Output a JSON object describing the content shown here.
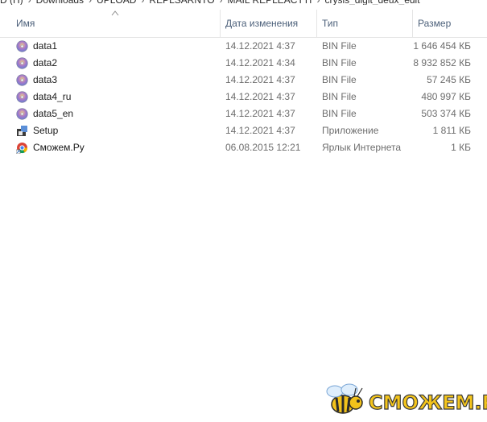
{
  "breadcrumb": {
    "items": [
      "D (H)",
      "Downloads",
      "UPLOAD",
      "REPLSARNTO",
      "MAIL REPLEACTTI",
      "crysis_digit_deux_edit"
    ],
    "separator": "›"
  },
  "columns": {
    "name": "Имя",
    "date": "Дата изменения",
    "type": "Тип",
    "size": "Размер"
  },
  "files": [
    {
      "name": "data1",
      "date": "14.12.2021 4:37",
      "type": "BIN File",
      "size": "1 646 454 КБ",
      "icon": "disc-icon"
    },
    {
      "name": "data2",
      "date": "14.12.2021 4:34",
      "type": "BIN File",
      "size": "8 932 852 КБ",
      "icon": "disc-icon"
    },
    {
      "name": "data3",
      "date": "14.12.2021 4:37",
      "type": "BIN File",
      "size": "57 245 КБ",
      "icon": "disc-icon"
    },
    {
      "name": "data4_ru",
      "date": "14.12.2021 4:37",
      "type": "BIN File",
      "size": "480 997 КБ",
      "icon": "disc-icon"
    },
    {
      "name": "data5_en",
      "date": "14.12.2021 4:37",
      "type": "BIN File",
      "size": "503 374 КБ",
      "icon": "disc-icon"
    },
    {
      "name": "Setup",
      "date": "14.12.2021 4:37",
      "type": "Приложение",
      "size": "1 811 КБ",
      "icon": "setup-icon"
    },
    {
      "name": "Сможем.Ру",
      "date": "06.08.2015 12:21",
      "type": "Ярлык Интернета",
      "size": "1 КБ",
      "icon": "chrome-shortcut-icon"
    }
  ],
  "watermark": {
    "text": "СМОЖЕМ.РУ"
  },
  "colors": {
    "header_text": "#4c607a",
    "meta_text": "#6d6d6d",
    "divider": "#e5e5e5"
  }
}
